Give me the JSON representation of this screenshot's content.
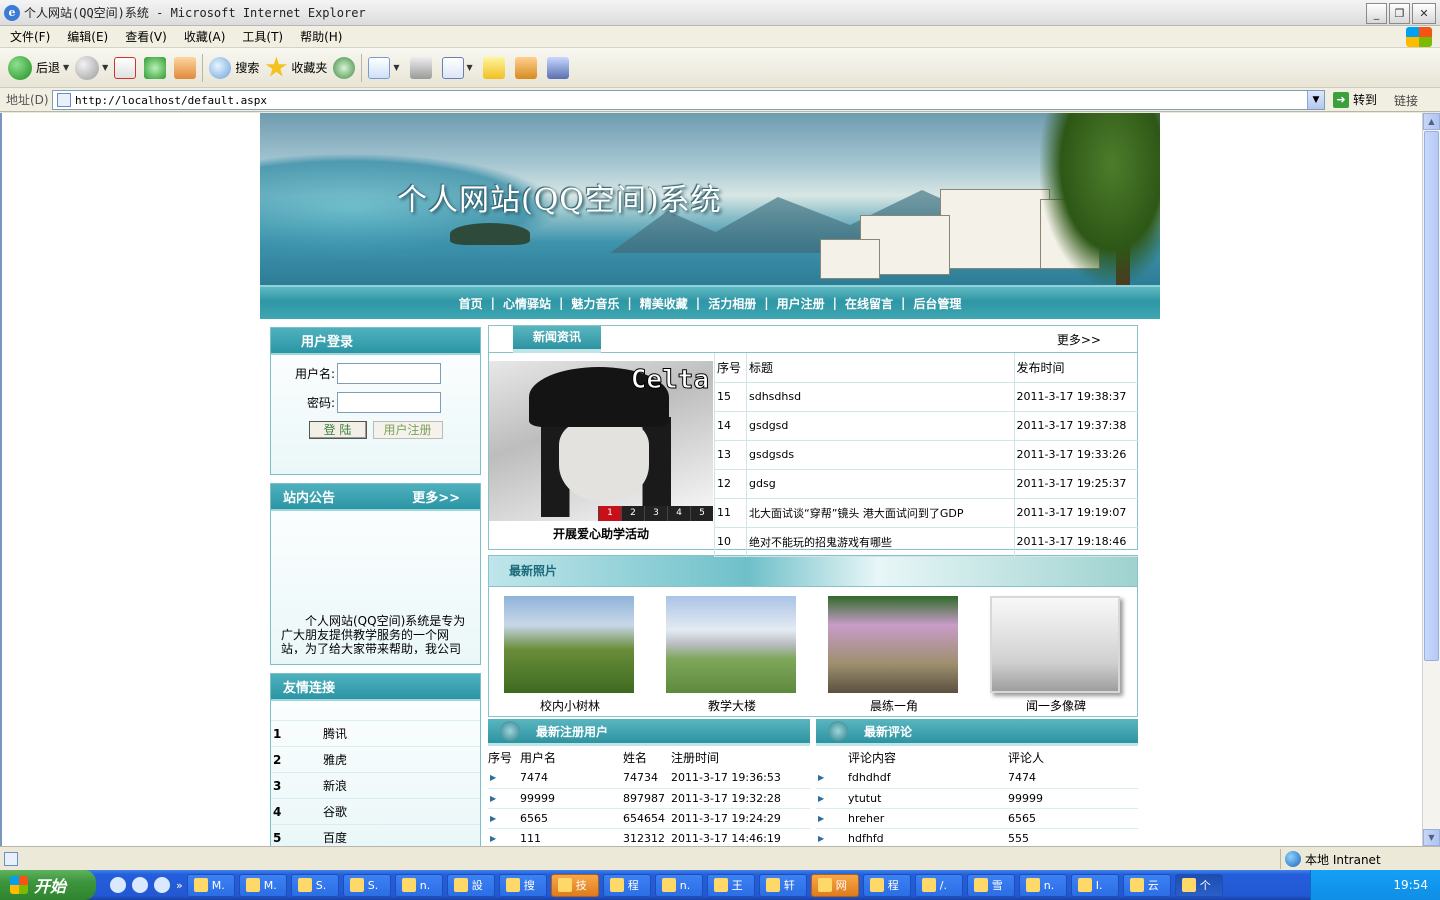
{
  "window": {
    "title": "个人网站(QQ空间)系统 - Microsoft Internet Explorer",
    "controls": {
      "minimize": "_",
      "maximize": "❐",
      "close": "✕"
    }
  },
  "menu": [
    "文件(F)",
    "编辑(E)",
    "查看(V)",
    "收藏(A)",
    "工具(T)",
    "帮助(H)"
  ],
  "toolbar": {
    "back": "后退",
    "search": "搜索",
    "favorites": "收藏夹"
  },
  "address": {
    "label": "地址(D)",
    "url": "http://localhost/default.aspx",
    "go": "转到",
    "links": "链接"
  },
  "site": {
    "title": "个人网站(QQ空间)系统",
    "nav": [
      "首页",
      "心情驿站",
      "魅力音乐",
      "精美收藏",
      "活力相册",
      "用户注册",
      "在线留言",
      "后台管理"
    ],
    "nav_sep": "|",
    "login": {
      "title": "用户登录",
      "username_label": "用户名:",
      "password_label": "密码:",
      "login_btn": "登 陆",
      "register_btn": "用户注册"
    },
    "notice": {
      "title": "站内公告",
      "more": "更多>>",
      "text": "个人网站(QQ空间)系统是专为广大朋友提供教学服务的一个网站，为了给大家带来帮助，我公司"
    },
    "friend_links": {
      "title": "友情连接",
      "items": [
        {
          "no": "1",
          "name": "腾讯"
        },
        {
          "no": "2",
          "name": "雅虎"
        },
        {
          "no": "3",
          "name": "新浪"
        },
        {
          "no": "4",
          "name": "谷歌"
        },
        {
          "no": "5",
          "name": "百度"
        }
      ]
    },
    "news": {
      "title": "新闻资讯",
      "more": "更多>>",
      "pic_logo": "Celta",
      "pic_pager": [
        "1",
        "2",
        "3",
        "4",
        "5"
      ],
      "pic_caption": "开展爱心助学活动",
      "headers": [
        "序号",
        "标题",
        "发布时间"
      ],
      "rows": [
        {
          "no": "15",
          "title": "sdhsdhsd",
          "time": "2011-3-17 19:38:37"
        },
        {
          "no": "14",
          "title": "gsdgsd",
          "time": "2011-3-17 19:37:38"
        },
        {
          "no": "13",
          "title": "gsdgsds",
          "time": "2011-3-17 19:33:26"
        },
        {
          "no": "12",
          "title": "gdsg",
          "time": "2011-3-17 19:25:37"
        },
        {
          "no": "11",
          "title": "北大面试谈“穿帮”镜头 港大面试问到了GDP",
          "time": "2011-3-17 19:19:07"
        },
        {
          "no": "10",
          "title": "绝对不能玩的招鬼游戏有哪些",
          "time": "2011-3-17 19:18:46"
        }
      ]
    },
    "photos": {
      "title": "最新照片",
      "items": [
        "校内小树林",
        "教学大楼",
        "晨练一角",
        "闻一多像碑"
      ]
    },
    "new_users": {
      "title": "最新注册用户",
      "headers": [
        "序号",
        "用户名",
        "姓名",
        "注册时间"
      ],
      "rows": [
        {
          "username": "7474",
          "name": "74734",
          "time": "2011-3-17 19:36:53"
        },
        {
          "username": "99999",
          "name": "897987",
          "time": "2011-3-17 19:32:28"
        },
        {
          "username": "6565",
          "name": "654654",
          "time": "2011-3-17 19:24:29"
        },
        {
          "username": "111",
          "name": "312312",
          "time": "2011-3-17 14:46:19"
        }
      ]
    },
    "new_comments": {
      "title": "最新评论",
      "headers": [
        "",
        "评论内容",
        "评论人"
      ],
      "rows": [
        {
          "content": "fdhdhdf",
          "user": "7474"
        },
        {
          "content": "ytutut",
          "user": "99999"
        },
        {
          "content": "hreher",
          "user": "6565"
        },
        {
          "content": "hdfhfd",
          "user": "555"
        }
      ]
    }
  },
  "status": {
    "zone": "本地 Intranet"
  },
  "taskbar": {
    "start": "开始",
    "tasks": [
      "M.",
      "M.",
      "S.",
      "S.",
      "n.",
      "設",
      "搜",
      "技",
      "程",
      "n.",
      "王",
      "轩",
      "网",
      "程",
      "/.",
      "雪",
      "n.",
      "I.",
      "云",
      "个"
    ],
    "clock": "19:54"
  },
  "colors": {
    "accent": "#2d93a1",
    "nav": "#3fa7b3",
    "taskbar": "#245edb",
    "start": "#3c943c"
  }
}
